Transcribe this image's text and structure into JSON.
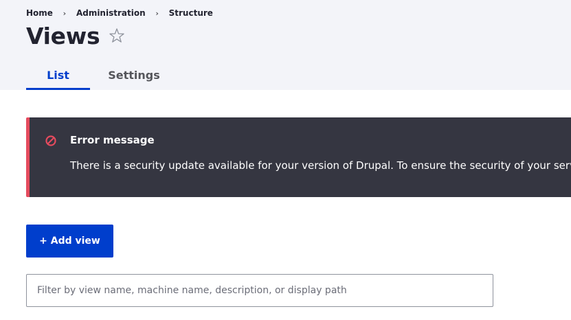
{
  "breadcrumb": {
    "items": [
      "Home",
      "Administration",
      "Structure"
    ],
    "separator": "›"
  },
  "page": {
    "title": "Views",
    "favorite_icon": "star-outline-icon"
  },
  "tabs": [
    {
      "label": "List",
      "active": true
    },
    {
      "label": "Settings",
      "active": false
    }
  ],
  "error": {
    "icon": "error-icon",
    "title": "Error message",
    "text": "There is a security update available for your version of Drupal. To ensure the security of your server, y"
  },
  "actions": {
    "add_view_label": "+ Add view"
  },
  "filter": {
    "placeholder": "Filter by view name, machine name, description, or display path",
    "value": ""
  },
  "colors": {
    "accent": "#003ecc",
    "header_bg": "#f3f4f9",
    "error_bg": "#353641",
    "error_accent": "#e54b5e"
  }
}
